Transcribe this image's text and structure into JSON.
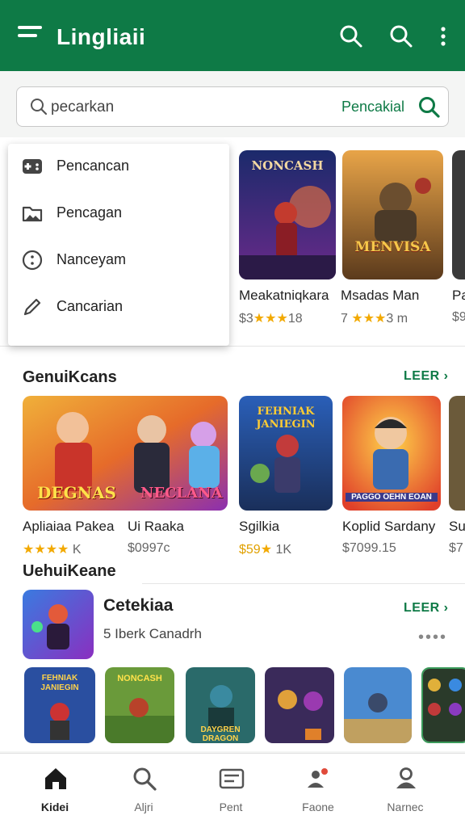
{
  "colors": {
    "brand": "#0e7a46",
    "star": "#f2a900"
  },
  "appbar": {
    "title": "Lingliaii",
    "icons": [
      "menu-icon",
      "search-icon",
      "search-icon",
      "more-vert-icon"
    ]
  },
  "search": {
    "placeholder": "pecarkan",
    "action_label": "Pencakial"
  },
  "popup_menu": {
    "items": [
      {
        "label": "Pencancan",
        "icon": "controller-icon"
      },
      {
        "label": "Pencagan",
        "icon": "folder-icon"
      },
      {
        "label": "Nanceyam",
        "icon": "smiley-icon"
      },
      {
        "label": "Cancarian",
        "icon": "pen-icon"
      }
    ]
  },
  "top_row": {
    "games": [
      {
        "name": "Meakatniqkara",
        "price": "$3",
        "stars": "★★★",
        "rating": "18"
      },
      {
        "name": "Msadas Man",
        "price": "7",
        "stars": "★★★",
        "rating": "3 m"
      },
      {
        "name": "Pa",
        "price": "$9",
        "stars": "",
        "rating": ""
      }
    ],
    "banner_texts": [
      "NONCASH",
      "MENVISA"
    ]
  },
  "section1": {
    "title": "GenuiKcans",
    "more_label": "LEER ›",
    "games": [
      {
        "name": "Apliaiaa Pakea",
        "price": "",
        "stars": "★★★★",
        "rating": "K"
      },
      {
        "name": "Ui Raaka",
        "price": "$0997c",
        "stars": "",
        "rating": ""
      },
      {
        "name": "Sgilkia",
        "price": "$59",
        "stars": "★",
        "rating": "1K"
      },
      {
        "name": "Koplid Sardany",
        "price": "$7099.15",
        "stars": "",
        "rating": ""
      },
      {
        "name": "Su",
        "price": "$7",
        "stars": "",
        "rating": ""
      }
    ],
    "banner_texts": [
      "DEGNAS",
      "NECLANA",
      "FEHNIAK JANIEGIN",
      "PAGGO OEHN EOAN"
    ]
  },
  "section2": {
    "title": "UehuiKeane",
    "more_label": "LEER ›",
    "featured": {
      "title": "Cetekiaa",
      "subtitle": "5 Iberk Canadrh"
    },
    "dots": "••••",
    "thumb_texts": [
      "FEHNIAK JANIEGIN",
      "NONCASH",
      "DAYGREN DRAGON"
    ]
  },
  "bottom_nav": {
    "items": [
      {
        "label": "Kidei",
        "icon": "home-icon",
        "active": true
      },
      {
        "label": "Aljri",
        "icon": "search-icon",
        "active": false
      },
      {
        "label": "Pent",
        "icon": "card-icon",
        "active": false
      },
      {
        "label": "Faone",
        "icon": "people-icon",
        "active": false
      },
      {
        "label": "Narnec",
        "icon": "person-icon",
        "active": false
      }
    ]
  }
}
